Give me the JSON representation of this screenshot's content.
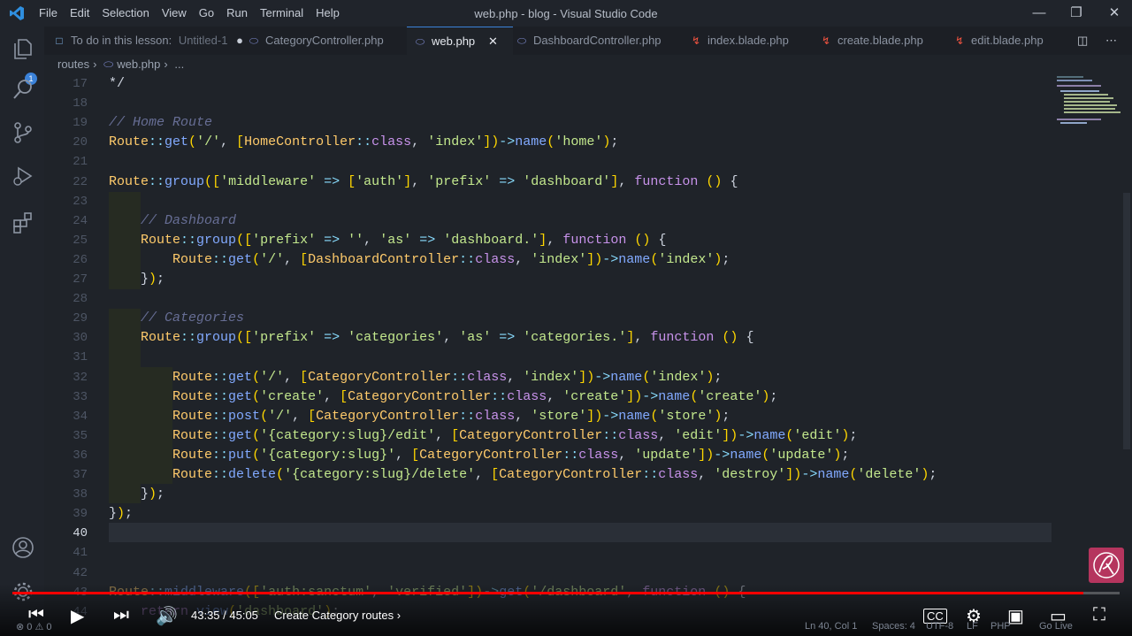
{
  "window": {
    "title": "web.php - blog - Visual Studio Code",
    "menu": [
      "File",
      "Edit",
      "Selection",
      "View",
      "Go",
      "Run",
      "Terminal",
      "Help"
    ]
  },
  "tabs": [
    {
      "label": "To do in this lesson:",
      "sublabel": "Untitled-1",
      "icon": "file-icon",
      "active": false,
      "modified": true
    },
    {
      "label": "CategoryController.php",
      "icon": "php-icon",
      "active": false
    },
    {
      "label": "web.php",
      "icon": "php-icon",
      "active": true
    },
    {
      "label": "DashboardController.php",
      "icon": "php-icon",
      "active": false
    },
    {
      "label": "index.blade.php",
      "icon": "blade-icon",
      "active": false
    },
    {
      "label": "create.blade.php",
      "icon": "blade-icon",
      "active": false
    },
    {
      "label": "edit.blade.php",
      "icon": "blade-icon",
      "active": false
    }
  ],
  "breadcrumb": [
    "routes",
    "web.php",
    "..."
  ],
  "explorer_badge": "1",
  "editor": {
    "current_line": "40",
    "lines": [
      {
        "n": "17",
        "text": "*/"
      },
      {
        "n": "18",
        "text": ""
      },
      {
        "n": "19",
        "text": "// Home Route"
      },
      {
        "n": "20",
        "text": "Route::get('/', [HomeController::class, 'index'])->name('home');"
      },
      {
        "n": "21",
        "text": ""
      },
      {
        "n": "22",
        "text": "Route::group(['middleware' => ['auth'], 'prefix' => 'dashboard'], function () {"
      },
      {
        "n": "23",
        "text": ""
      },
      {
        "n": "24",
        "text": "    // Dashboard"
      },
      {
        "n": "25",
        "text": "    Route::group(['prefix' => '', 'as' => 'dashboard.'], function () {"
      },
      {
        "n": "26",
        "text": "        Route::get('/', [DashboardController::class, 'index'])->name('index');"
      },
      {
        "n": "27",
        "text": "    });"
      },
      {
        "n": "28",
        "text": ""
      },
      {
        "n": "29",
        "text": "    // Categories"
      },
      {
        "n": "30",
        "text": "    Route::group(['prefix' => 'categories', 'as' => 'categories.'], function () {"
      },
      {
        "n": "31",
        "text": ""
      },
      {
        "n": "32",
        "text": "        Route::get('/', [CategoryController::class, 'index'])->name('index');"
      },
      {
        "n": "33",
        "text": "        Route::get('create', [CategoryController::class, 'create'])->name('create');"
      },
      {
        "n": "34",
        "text": "        Route::post('/', [CategoryController::class, 'store'])->name('store');"
      },
      {
        "n": "35",
        "text": "        Route::get('{category:slug}/edit', [CategoryController::class, 'edit'])->name('edit');"
      },
      {
        "n": "36",
        "text": "        Route::put('{category:slug}', [CategoryController::class, 'update'])->name('update');"
      },
      {
        "n": "37",
        "text": "        Route::delete('{category:slug}/delete', [CategoryController::class, 'destroy'])->name('delete');"
      },
      {
        "n": "38",
        "text": "    });"
      },
      {
        "n": "39",
        "text": "});"
      },
      {
        "n": "40",
        "text": ""
      },
      {
        "n": "41",
        "text": ""
      },
      {
        "n": "42",
        "text": ""
      },
      {
        "n": "43",
        "text": "Route::middleware(['auth:sanctum', 'verified'])->get('/dashboard', function () {"
      },
      {
        "n": "44",
        "text": "    return view('dashboard');"
      }
    ]
  },
  "player": {
    "time": "43:35 / 45:05",
    "chapter": "Create Category routes",
    "progress": 0.967
  },
  "statusbar": {
    "left": "⊗ 0 ⚠ 0",
    "position": "Ln 40, Col 1",
    "spaces": "Spaces: 4",
    "encoding": "UTF-8",
    "eol": "LF",
    "language": "PHP",
    "golive": "Go Live"
  }
}
